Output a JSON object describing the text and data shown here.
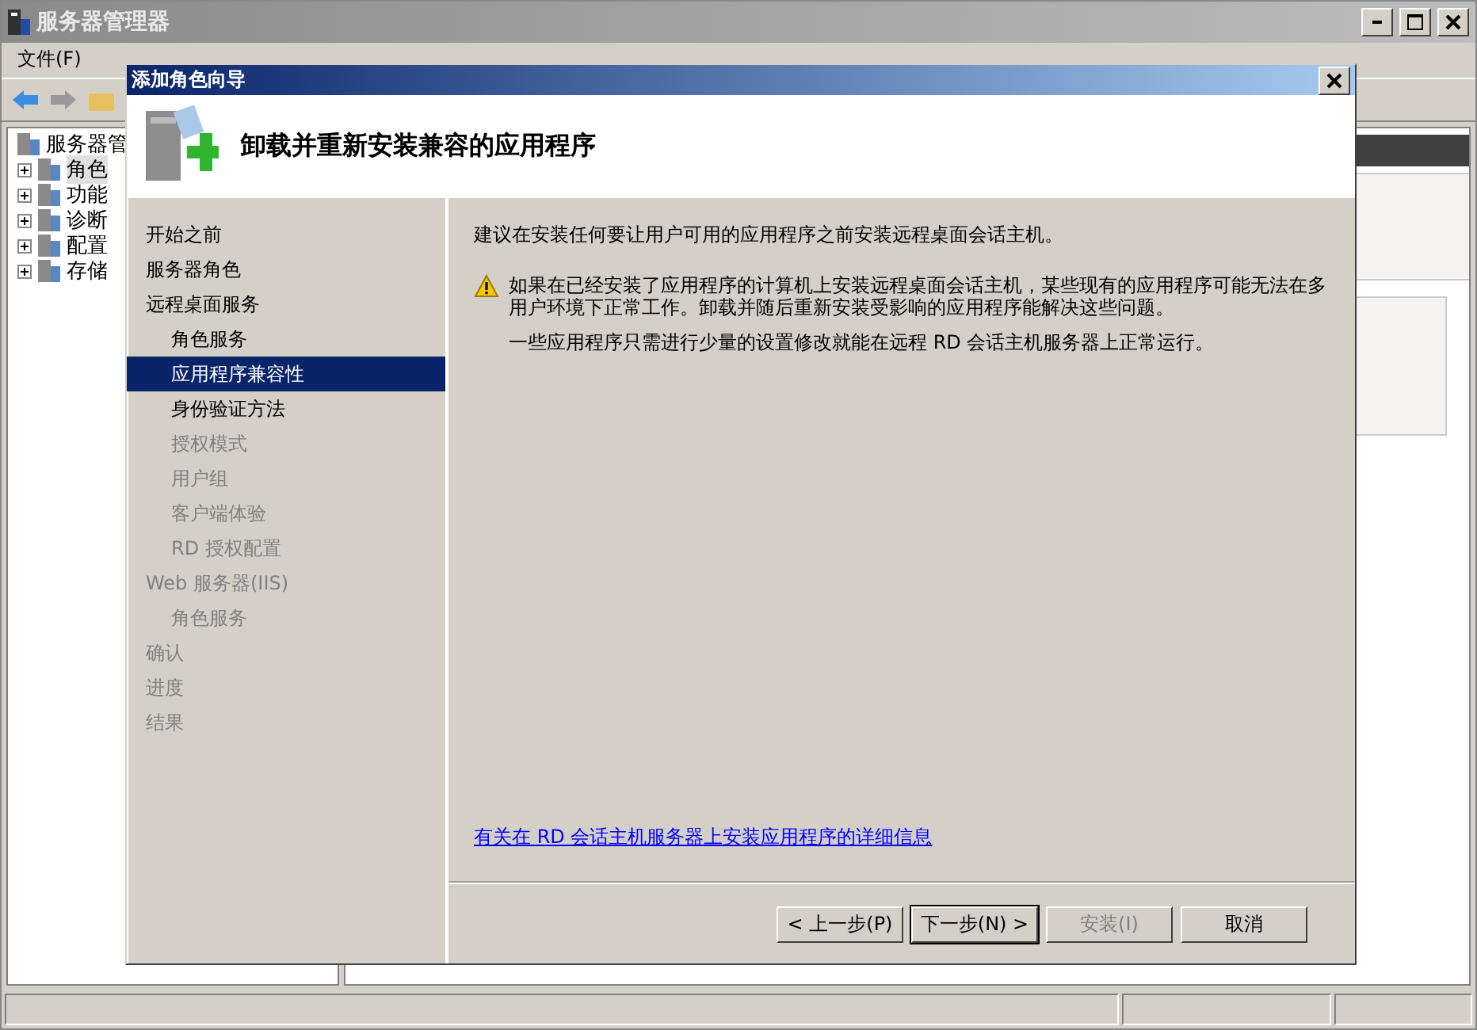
{
  "window": {
    "title": "服务器管理器"
  },
  "menu": [
    "文件(F)"
  ],
  "tree": {
    "root": "服务器管",
    "items": [
      {
        "label": "角色",
        "selected": true,
        "expanded": false
      },
      {
        "label": "功能",
        "selected": false,
        "expanded": false
      },
      {
        "label": "诊断",
        "selected": false,
        "expanded": false
      },
      {
        "label": "配置",
        "selected": false,
        "expanded": false
      },
      {
        "label": "存储",
        "selected": false,
        "expanded": false
      }
    ]
  },
  "dialog": {
    "title": "添加角色向导",
    "heading": "卸载并重新安装兼容的应用程序",
    "steps": [
      {
        "label": "开始之前",
        "selected": false,
        "disabled": false
      },
      {
        "label": "服务器角色",
        "selected": false,
        "disabled": false
      },
      {
        "label": "远程桌面服务",
        "selected": false,
        "disabled": false,
        "children": [
          {
            "label": "角色服务",
            "selected": false,
            "disabled": false
          },
          {
            "label": "应用程序兼容性",
            "selected": true,
            "disabled": false
          },
          {
            "label": "身份验证方法",
            "selected": false,
            "disabled": false
          },
          {
            "label": "授权模式",
            "selected": false,
            "disabled": true
          },
          {
            "label": "用户组",
            "selected": false,
            "disabled": true
          },
          {
            "label": "客户端体验",
            "selected": false,
            "disabled": true
          },
          {
            "label": "RD 授权配置",
            "selected": false,
            "disabled": true
          }
        ]
      },
      {
        "label": "Web 服务器(IIS)",
        "selected": false,
        "disabled": true,
        "children": [
          {
            "label": "角色服务",
            "selected": false,
            "disabled": true
          }
        ]
      },
      {
        "label": "确认",
        "selected": false,
        "disabled": true
      },
      {
        "label": "进度",
        "selected": false,
        "disabled": true
      },
      {
        "label": "结果",
        "selected": false,
        "disabled": true
      }
    ],
    "intro": "建议在安装任何要让用户可用的应用程序之前安装远程桌面会话主机。",
    "warning": "如果在已经安装了应用程序的计算机上安装远程桌面会话主机，某些现有的应用程序可能无法在多用户环境下正常工作。卸载并随后重新安装受影响的应用程序能解决这些问题。",
    "note": "一些应用程序只需进行少量的设置修改就能在远程 RD 会话主机服务器上正常运行。",
    "link": "有关在 RD 会话主机服务器上安装应用程序的详细信息",
    "buttons": [
      {
        "label": "< 上一步(P)",
        "disabled": false,
        "default": false
      },
      {
        "label": "下一步(N) >",
        "disabled": false,
        "default": true
      },
      {
        "label": "安装(I)",
        "disabled": true,
        "default": false
      },
      {
        "label": "取消",
        "disabled": false,
        "default": false
      }
    ]
  }
}
